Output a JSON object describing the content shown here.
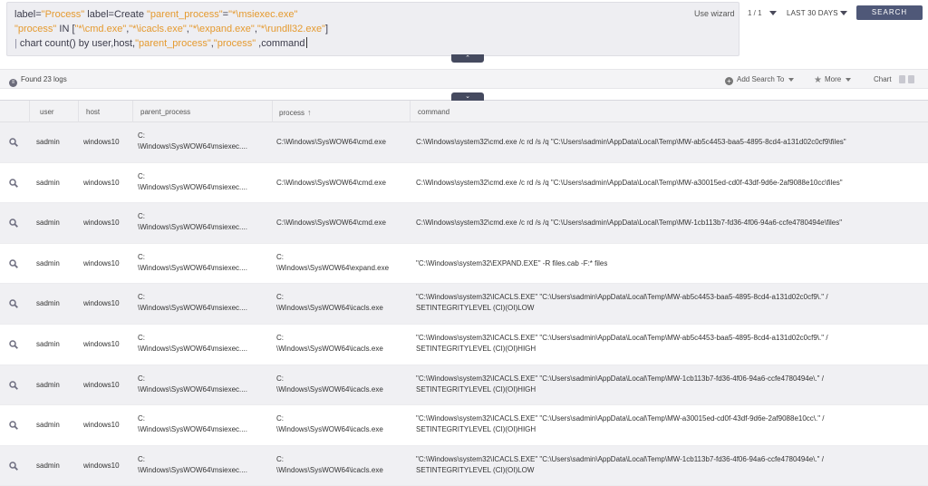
{
  "query": {
    "line1": [
      {
        "t": "label=",
        "c": "plain"
      },
      {
        "t": "\"Process\"",
        "c": "str"
      },
      {
        "t": " label=Create ",
        "c": "plain"
      },
      {
        "t": "\"parent_process\"",
        "c": "str"
      },
      {
        "t": "=",
        "c": "plain"
      },
      {
        "t": "\"*\\msiexec.exe\"",
        "c": "str"
      }
    ],
    "line2": [
      {
        "t": "\"process\"",
        "c": "str"
      },
      {
        "t": " IN [",
        "c": "plain"
      },
      {
        "t": "\"*\\cmd.exe\"",
        "c": "str"
      },
      {
        "t": ",",
        "c": "plain"
      },
      {
        "t": "\"*\\icacls.exe\"",
        "c": "str"
      },
      {
        "t": ",",
        "c": "plain"
      },
      {
        "t": "\"*\\expand.exe\"",
        "c": "str"
      },
      {
        "t": ",",
        "c": "plain"
      },
      {
        "t": "\"*\\rundll32.exe\"",
        "c": "str"
      },
      {
        "t": "]",
        "c": "plain"
      }
    ],
    "line3": [
      {
        "t": "| ",
        "c": "pipe"
      },
      {
        "t": "chart count() by user,host,",
        "c": "plain"
      },
      {
        "t": "\"parent_process\"",
        "c": "str"
      },
      {
        "t": ",",
        "c": "plain"
      },
      {
        "t": "\"process\"",
        "c": "str"
      },
      {
        "t": " ,command",
        "c": "plain"
      }
    ]
  },
  "controls": {
    "use_wizard": "Use wizard",
    "page_count": "1 / 1",
    "time_range": "LAST 30 DAYS",
    "search_button": "SEARCH",
    "collapse_up": "⌃",
    "collapse_down": "⌄"
  },
  "toolbar": {
    "found": "Found 23 logs",
    "add_search": "Add Search To",
    "more": "More",
    "chart": "Chart"
  },
  "table": {
    "columns": [
      "user",
      "host",
      "parent_process",
      "process",
      "command"
    ],
    "rows": [
      {
        "user": "sadmin",
        "host": "windows10",
        "parent1": "C:",
        "parent2": "\\Windows\\SysWOW64\\msiexec....",
        "proc1": "C:\\Windows\\SysWOW64\\cmd.exe",
        "proc2": "",
        "cmd1": "C:\\Windows\\system32\\cmd.exe /c rd /s /q \"C:\\Users\\sadmin\\AppData\\Local\\Temp\\MW-ab5c4453-baa5-4895-8cd4-a131d02c0cf9\\files\"",
        "cmd2": ""
      },
      {
        "user": "sadmin",
        "host": "windows10",
        "parent1": "C:",
        "parent2": "\\Windows\\SysWOW64\\msiexec....",
        "proc1": "C:\\Windows\\SysWOW64\\cmd.exe",
        "proc2": "",
        "cmd1": "C:\\Windows\\system32\\cmd.exe /c rd /s /q \"C:\\Users\\sadmin\\AppData\\Local\\Temp\\MW-a30015ed-cd0f-43df-9d6e-2af9088e10cc\\files\"",
        "cmd2": ""
      },
      {
        "user": "sadmin",
        "host": "windows10",
        "parent1": "C:",
        "parent2": "\\Windows\\SysWOW64\\msiexec....",
        "proc1": "C:\\Windows\\SysWOW64\\cmd.exe",
        "proc2": "",
        "cmd1": "C:\\Windows\\system32\\cmd.exe /c rd /s /q \"C:\\Users\\sadmin\\AppData\\Local\\Temp\\MW-1cb113b7-fd36-4f06-94a6-ccfe4780494e\\files\"",
        "cmd2": ""
      },
      {
        "user": "sadmin",
        "host": "windows10",
        "parent1": "C:",
        "parent2": "\\Windows\\SysWOW64\\msiexec....",
        "proc1": "C:",
        "proc2": "\\Windows\\SysWOW64\\expand.exe",
        "cmd1": "\"C:\\Windows\\system32\\EXPAND.EXE\" -R files.cab -F:* files",
        "cmd2": ""
      },
      {
        "user": "sadmin",
        "host": "windows10",
        "parent1": "C:",
        "parent2": "\\Windows\\SysWOW64\\msiexec....",
        "proc1": "C:",
        "proc2": "\\Windows\\SysWOW64\\icacls.exe",
        "cmd1": "\"C:\\Windows\\system32\\ICACLS.EXE\" \"C:\\Users\\sadmin\\AppData\\Local\\Temp\\MW-ab5c4453-baa5-4895-8cd4-a131d02c0cf9\\.\" /",
        "cmd2": "SETINTEGRITYLEVEL (CI)(OI)LOW"
      },
      {
        "user": "sadmin",
        "host": "windows10",
        "parent1": "C:",
        "parent2": "\\Windows\\SysWOW64\\msiexec....",
        "proc1": "C:",
        "proc2": "\\Windows\\SysWOW64\\icacls.exe",
        "cmd1": "\"C:\\Windows\\system32\\ICACLS.EXE\" \"C:\\Users\\sadmin\\AppData\\Local\\Temp\\MW-ab5c4453-baa5-4895-8cd4-a131d02c0cf9\\.\" /",
        "cmd2": "SETINTEGRITYLEVEL (CI)(OI)HIGH"
      },
      {
        "user": "sadmin",
        "host": "windows10",
        "parent1": "C:",
        "parent2": "\\Windows\\SysWOW64\\msiexec....",
        "proc1": "C:",
        "proc2": "\\Windows\\SysWOW64\\icacls.exe",
        "cmd1": "\"C:\\Windows\\system32\\ICACLS.EXE\" \"C:\\Users\\sadmin\\AppData\\Local\\Temp\\MW-1cb113b7-fd36-4f06-94a6-ccfe4780494e\\.\" /",
        "cmd2": "SETINTEGRITYLEVEL (CI)(OI)HIGH"
      },
      {
        "user": "sadmin",
        "host": "windows10",
        "parent1": "C:",
        "parent2": "\\Windows\\SysWOW64\\msiexec....",
        "proc1": "C:",
        "proc2": "\\Windows\\SysWOW64\\icacls.exe",
        "cmd1": "\"C:\\Windows\\system32\\ICACLS.EXE\" \"C:\\Users\\sadmin\\AppData\\Local\\Temp\\MW-a30015ed-cd0f-43df-9d6e-2af9088e10cc\\.\" /",
        "cmd2": "SETINTEGRITYLEVEL (CI)(OI)HIGH"
      },
      {
        "user": "sadmin",
        "host": "windows10",
        "parent1": "C:",
        "parent2": "\\Windows\\SysWOW64\\msiexec....",
        "proc1": "C:",
        "proc2": "\\Windows\\SysWOW64\\icacls.exe",
        "cmd1": "\"C:\\Windows\\system32\\ICACLS.EXE\" \"C:\\Users\\sadmin\\AppData\\Local\\Temp\\MW-1cb113b7-fd36-4f06-94a6-ccfe4780494e\\.\" /",
        "cmd2": "SETINTEGRITYLEVEL (CI)(OI)LOW"
      }
    ]
  },
  "colors": {
    "accent_orange": "#e59a2f",
    "search_button": "#4f5878",
    "handle": "#454a5f"
  }
}
